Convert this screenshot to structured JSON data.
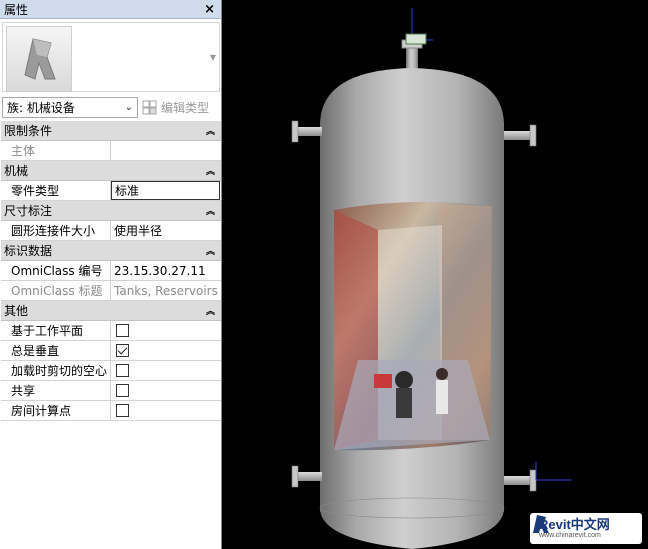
{
  "palette": {
    "title": "属性",
    "close_glyph": "×",
    "preview_dropdown_glyph": "▼",
    "family_select_value": "族: 机械设备",
    "edit_type_label": "编辑类型",
    "sections": {
      "constraints": {
        "title": "限制条件",
        "host_label": "主体",
        "host_value": ""
      },
      "mechanical": {
        "title": "机械",
        "part_type_label": "零件类型",
        "part_type_value": "标准"
      },
      "dimensions": {
        "title": "尺寸标注",
        "radius_label": "圆形连接件大小",
        "radius_value": "使用半径"
      },
      "identity": {
        "title": "标识数据",
        "omniclass_number_label": "OmniClass 编号",
        "omniclass_number_value": "23.15.30.27.11",
        "omniclass_title_label": "OmniClass 标题",
        "omniclass_title_value": "Tanks, Reservoirs"
      },
      "other": {
        "title": "其他",
        "rows": [
          {
            "label": "基于工作平面",
            "checked": false
          },
          {
            "label": "总是垂直",
            "checked": true
          },
          {
            "label": "加载时剪切的空心",
            "checked": false
          },
          {
            "label": "共享",
            "checked": false
          },
          {
            "label": "房间计算点",
            "checked": false
          }
        ]
      }
    },
    "collapse_glyph": "»"
  },
  "watermark": {
    "brand": "Revit中文网",
    "url": "www.chinarevit.com"
  },
  "colors": {
    "accent_blue": "#1f3fd8",
    "vessel_gray": "#b8b8b8",
    "section_bg": "#dcdcdc"
  }
}
